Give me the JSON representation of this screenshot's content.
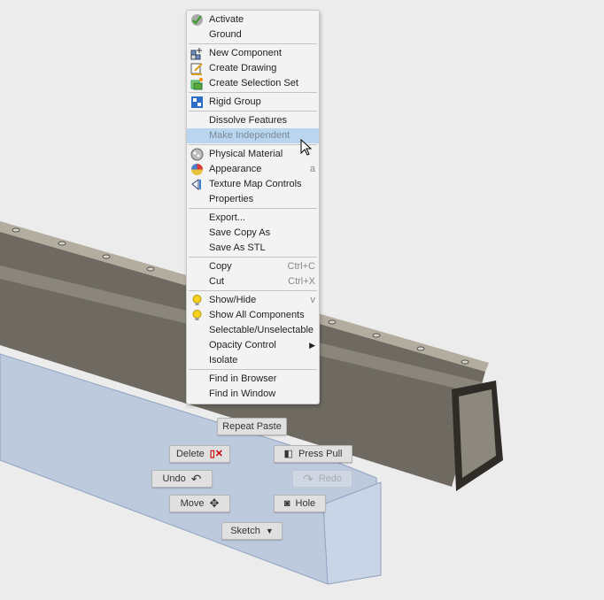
{
  "context_menu": {
    "groups": [
      [
        {
          "label": "Activate",
          "icon": "check-icon"
        },
        {
          "label": "Ground"
        }
      ],
      [
        {
          "label": "New Component",
          "icon": "new-component-icon"
        },
        {
          "label": "Create Drawing",
          "icon": "drawing-icon"
        },
        {
          "label": "Create Selection Set",
          "icon": "selection-set-icon"
        }
      ],
      [
        {
          "label": "Rigid Group",
          "icon": "rigid-group-icon"
        }
      ],
      [
        {
          "label": "Dissolve Features"
        },
        {
          "label": "Make Independent",
          "highlighted": true,
          "disabled": true
        }
      ],
      [
        {
          "label": "Physical Material",
          "icon": "material-icon"
        },
        {
          "label": "Appearance",
          "icon": "appearance-icon",
          "shortcut": "a"
        },
        {
          "label": "Texture Map Controls",
          "icon": "texture-icon"
        },
        {
          "label": "Properties"
        }
      ],
      [
        {
          "label": "Export..."
        },
        {
          "label": "Save Copy As"
        },
        {
          "label": "Save As STL"
        }
      ],
      [
        {
          "label": "Copy",
          "shortcut": "Ctrl+C"
        },
        {
          "label": "Cut",
          "shortcut": "Ctrl+X"
        }
      ],
      [
        {
          "label": "Show/Hide",
          "icon": "lightbulb-icon",
          "shortcut": "v"
        },
        {
          "label": "Show All Components",
          "icon": "lightbulb-icon"
        },
        {
          "label": "Selectable/Unselectable"
        },
        {
          "label": "Opacity Control",
          "submenu": true
        },
        {
          "label": "Isolate"
        }
      ],
      [
        {
          "label": "Find in Browser"
        },
        {
          "label": "Find in Window"
        }
      ]
    ]
  },
  "marking_menu": {
    "repeat_paste": "Repeat Paste",
    "delete": "Delete",
    "press_pull": "Press Pull",
    "undo": "Undo",
    "redo": "Redo",
    "move": "Move",
    "hole": "Hole",
    "sketch": "Sketch"
  },
  "colors": {
    "highlight": "#b9d5ef",
    "beam_dark": "#6f6a60",
    "beam_blue": "#b7c6dc"
  }
}
